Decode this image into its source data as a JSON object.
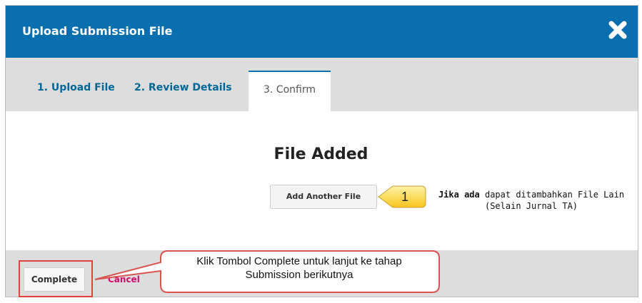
{
  "dialog": {
    "title": "Upload Submission File",
    "accent_color": "#0a6fae",
    "close_icon": "close-x-icon"
  },
  "tabs": [
    {
      "label": "1. Upload File",
      "active": false
    },
    {
      "label": "2. Review Details",
      "active": false
    },
    {
      "label": "3. Confirm",
      "active": true
    }
  ],
  "content": {
    "heading": "File Added",
    "add_button_label": "Add Another File"
  },
  "annotations": {
    "marker_number": "1",
    "note_bold": "Jika ada",
    "note_line1_rest": " dapat ditambahkan File Lain",
    "note_line2": "(Selain Jurnal TA)",
    "callout_line1": "Klik Tombol Complete untuk lanjut ke tahap",
    "callout_line2": "Submission berikutnya",
    "callout_color": "#ffd54a",
    "highlight_color": "#e0443a"
  },
  "footer": {
    "complete_label": "Complete",
    "cancel_label": "Cancel",
    "cancel_color": "#d00a6c"
  }
}
